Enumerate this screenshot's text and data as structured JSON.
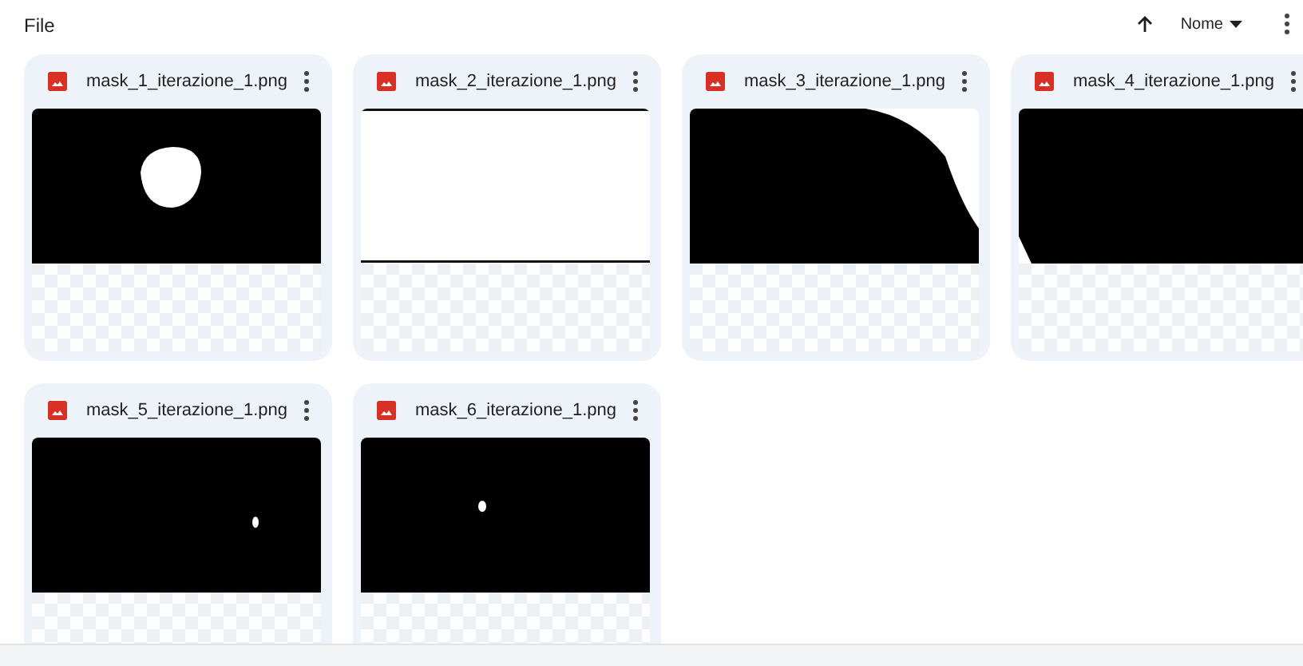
{
  "section_title": "File",
  "sort": {
    "label": "Nome"
  },
  "files": [
    {
      "name": "mask_1_iterazione_1.png"
    },
    {
      "name": "mask_2_iterazione_1.png"
    },
    {
      "name": "mask_3_iterazione_1.png"
    },
    {
      "name": "mask_4_iterazione_1.png"
    },
    {
      "name": "mask_5_iterazione_1.png"
    },
    {
      "name": "mask_6_iterazione_1.png"
    }
  ]
}
